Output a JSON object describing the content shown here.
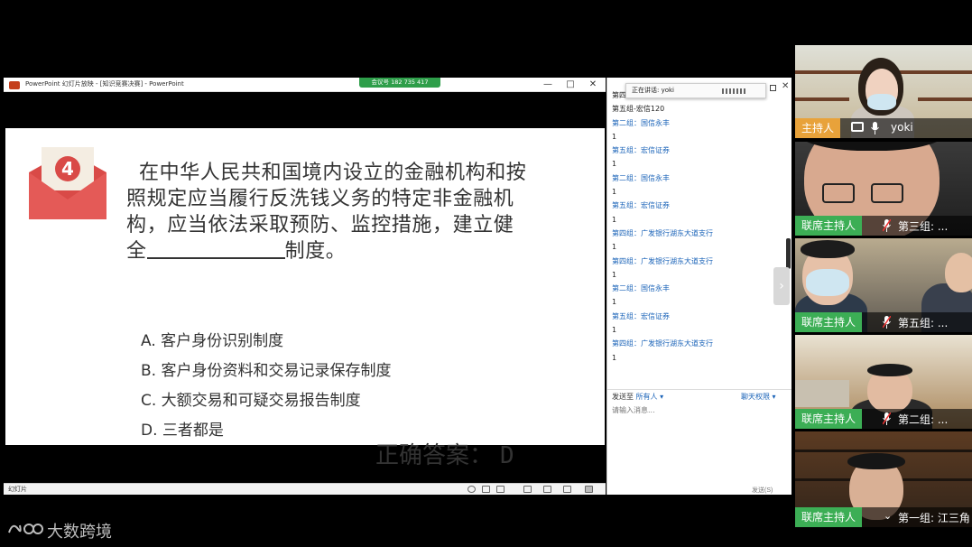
{
  "ppt": {
    "title": "PowerPoint 幻灯片放映 - [知识竞赛决赛] - PowerPoint",
    "meeting_id": "会议号 182 735 417",
    "controls": {
      "minimize": "—",
      "maximize": "□",
      "close": "✕"
    },
    "status_label": "幻灯片"
  },
  "slide": {
    "number": "4",
    "question_lines": [
      "在中华人民共和国境内设立的金融机构和按",
      "照规定应当履行反洗钱义务的特定非金融机",
      "构，应当依法采取预防、监控措施，建立健"
    ],
    "question_last_prefix": "全",
    "question_last_suffix": "制度。",
    "options": [
      "A. 客户身份识别制度",
      "B. 客户身份资料和交易记录保存制度",
      "C. 大额交易和可疑交易报告制度",
      "D. 三者都是"
    ],
    "answer_label": "正确答案：",
    "answer_value": "D"
  },
  "chat": {
    "speaking": "正在讲话: yoki",
    "messages": [
      {
        "name": "第四组 广发110",
        "text": ""
      },
      {
        "name": "第五组-宏信120",
        "text": ""
      },
      {
        "name": "第二组：国信永丰",
        "text": "1"
      },
      {
        "name": "第五组：宏信证券",
        "text": "1"
      },
      {
        "name": "第二组：国信永丰",
        "text": "1"
      },
      {
        "name": "第五组：宏信证券",
        "text": "1"
      },
      {
        "name": "第四组：广发银行湖东大道支行",
        "text": "1"
      },
      {
        "name": "第四组：广发银行湖东大道支行",
        "text": "1"
      },
      {
        "name": "第二组：国信永丰",
        "text": "1"
      },
      {
        "name": "第五组：宏信证券",
        "text": "1"
      },
      {
        "name": "第四组：广发银行湖东大道支行",
        "text": "1"
      }
    ],
    "send_to_label": "发送至",
    "send_to_value": "所有人 ▾",
    "permission": "聊天权限 ▾",
    "input_placeholder": "请输入消息...",
    "send_button": "发送(S)"
  },
  "panel_toggle": "›",
  "participants": [
    {
      "role": "主持人",
      "name": "yoki"
    },
    {
      "role": "联席主持人",
      "name": "第三组: ..."
    },
    {
      "role": "联席主持人",
      "name": "第五组: ..."
    },
    {
      "role": "联席主持人",
      "name": "第二组: ..."
    },
    {
      "role": "联席主持人",
      "name": "第一组: 江三角"
    }
  ],
  "watermark": {
    "text": "大数跨境"
  },
  "colors": {
    "co_host_badge": "#3cae55",
    "host_badge": "#e8a23a",
    "chat_name": "#1a63b8",
    "envelope": "#e05552"
  }
}
